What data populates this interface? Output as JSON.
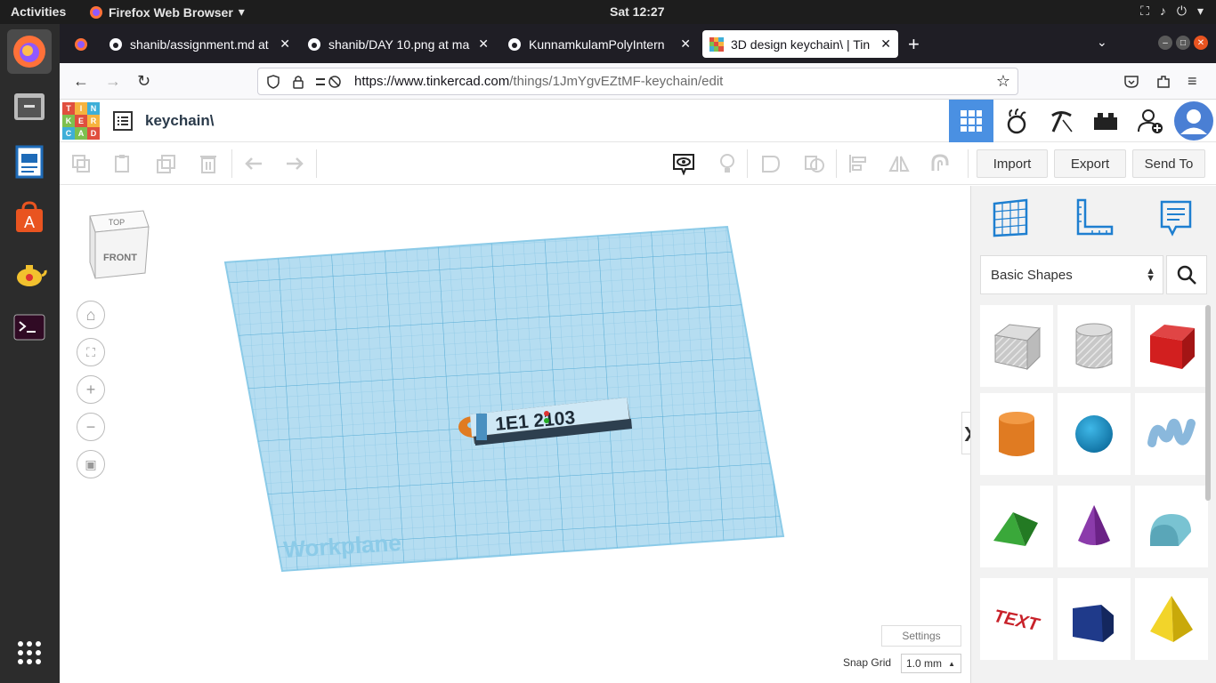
{
  "system": {
    "activities": "Activities",
    "app_name": "Firefox Web Browser",
    "clock": "Sat 12:27"
  },
  "tabs": [
    {
      "label": "shanib/assignment.md at",
      "active": false
    },
    {
      "label": "shanib/DAY 10.png at ma",
      "active": false
    },
    {
      "label": "KunnamkulamPolyIntern",
      "active": false
    },
    {
      "label": "3D design keychain\\ | Tin",
      "active": true
    }
  ],
  "url": {
    "host": "https://www.tinkercad.com",
    "path": "/things/1JmYgvEZtMF-keychain/edit"
  },
  "tinkercad": {
    "logo_letters": [
      "T",
      "I",
      "N",
      "K",
      "E",
      "R",
      "C",
      "A",
      "D"
    ],
    "design_title": "keychain\\",
    "actions": {
      "import": "Import",
      "export": "Export",
      "send_to": "Send To"
    },
    "viewcube": {
      "top": "TOP",
      "front": "FRONT"
    },
    "workplane_label": "Workplane",
    "keychain_text": "1E1 2103",
    "settings_label": "Settings",
    "snap_grid_label": "Snap Grid",
    "snap_grid_value": "1.0 mm",
    "shape_category": "Basic Shapes",
    "shapes": [
      "Box",
      "Cylinder",
      "Box",
      "Cylinder",
      "Sphere",
      "Scribble",
      "Roof",
      "Cone",
      "Round Roof",
      "Text",
      "Polygon",
      "Pyramid"
    ],
    "text_shape_label": "TEXT"
  },
  "colors": {
    "accent_blue": "#4a90e2",
    "workplane": "#a9d6ee",
    "grid_line": "#6fb6d9"
  }
}
